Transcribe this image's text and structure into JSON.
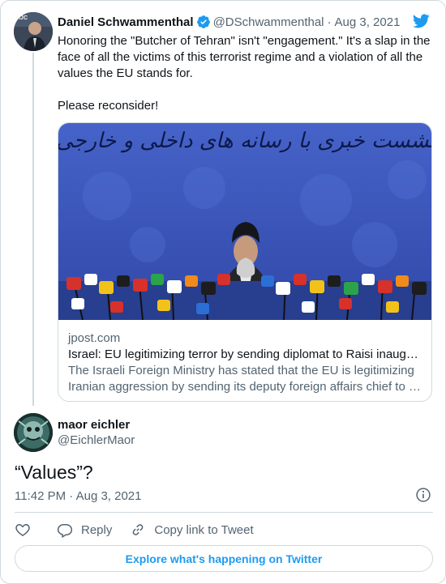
{
  "tweet": {
    "author_name": "Daniel Schwammenthal",
    "author_handle": "@DSchwammenthal",
    "separator": "·",
    "date": "Aug 3, 2021",
    "text": "Honoring the \"Butcher of Tehran\" isn't \"engagement.\" It's a slap in the face of all the victims of this terrorist regime and a violation of all the values the EU stands for.\n\nPlease reconsider!",
    "link_card": {
      "domain": "jpost.com",
      "title": "Israel: EU legitimizing terror by sending diplomat to Raisi inaug…",
      "description": "The Israeli Foreign Ministry has stated that the EU is legitimizing Iranian aggression by sending its deputy foreign affairs chief to …",
      "image_banner_text": "نشست خبری با رسانه های داخلی و خارجی"
    }
  },
  "reply": {
    "author_name": "maor eichler",
    "author_handle": "@EichlerMaor",
    "text": "“Values”?",
    "time": "11:42 PM · Aug 3, 2021"
  },
  "actions": {
    "reply_label": "Reply",
    "copy_label": "Copy link to Tweet"
  },
  "footer": {
    "explore_label": "Explore what's happening on Twitter"
  },
  "colors": {
    "accent": "#1d9bf0",
    "secondary_text": "#536471",
    "border": "#cfd9de",
    "banner_blue": "#3a53b8"
  },
  "icons": [
    "verified-badge-icon",
    "twitter-bird-icon",
    "info-icon",
    "heart-icon",
    "reply-bubble-icon",
    "link-icon"
  ]
}
